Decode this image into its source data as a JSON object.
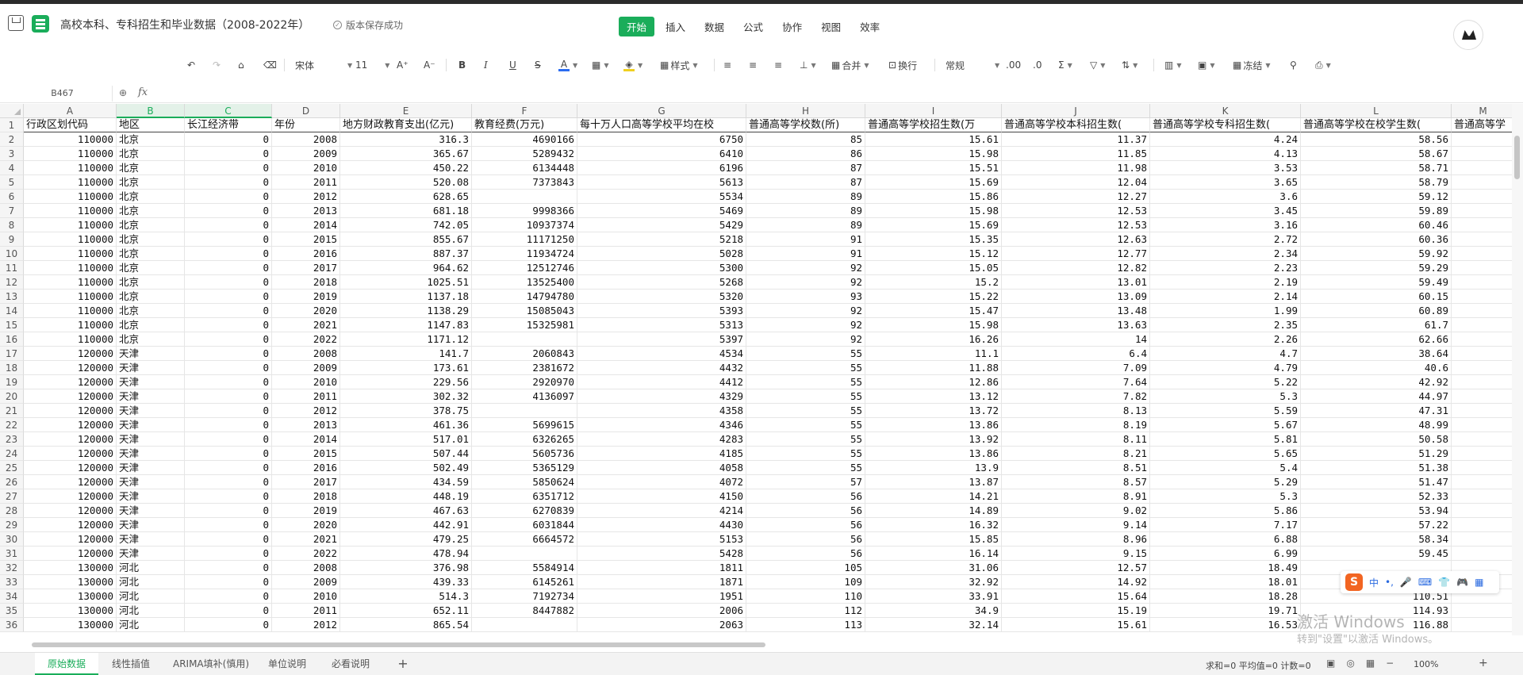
{
  "header": {
    "title": "高校本科、专科招生和毕业数据（2008-2022年）",
    "save_status": "版本保存成功",
    "menu_tabs": [
      "开始",
      "插入",
      "数据",
      "公式",
      "协作",
      "视图",
      "效率"
    ],
    "active_tab": "开始"
  },
  "toolbar": {
    "font_name": "宋体",
    "font_size": "11",
    "font_grow": "A⁺",
    "font_shrink": "A⁻",
    "bold": "B",
    "italic": "I",
    "underline": "U",
    "strike": "S",
    "font_color": "A",
    "style_label": "样式",
    "merge_label": "合并",
    "wrap_label": "换行",
    "number_format": "常规",
    "freeze_label": "冻结",
    "dec_increase": ".00",
    "dec_decrease": ".0"
  },
  "formula_bar": {
    "name_box": "B467",
    "fx": "fx",
    "value": ""
  },
  "columns": [
    "A",
    "B",
    "C",
    "D",
    "E",
    "F",
    "G",
    "H",
    "I",
    "J",
    "K",
    "L",
    "M"
  ],
  "headers": [
    "行政区划代码",
    "地区",
    "长江经济带",
    "年份",
    "地方财政教育支出(亿元)",
    "教育经费(万元)",
    "每十万人口高等学校平均在校",
    "普通高等学校数(所)",
    "普通高等学校招生数(万",
    "普通高等学校本科招生数(",
    "普通高等学校专科招生数(",
    "普通高等学校在校学生数(",
    "普通高等学"
  ],
  "rows": [
    [
      "110000",
      "北京",
      "0",
      "2008",
      "316.3",
      "4690166",
      "6750",
      "85",
      "15.61",
      "11.37",
      "4.24",
      "58.56"
    ],
    [
      "110000",
      "北京",
      "0",
      "2009",
      "365.67",
      "5289432",
      "6410",
      "86",
      "15.98",
      "11.85",
      "4.13",
      "58.67"
    ],
    [
      "110000",
      "北京",
      "0",
      "2010",
      "450.22",
      "6134448",
      "6196",
      "87",
      "15.51",
      "11.98",
      "3.53",
      "58.71"
    ],
    [
      "110000",
      "北京",
      "0",
      "2011",
      "520.08",
      "7373843",
      "5613",
      "87",
      "15.69",
      "12.04",
      "3.65",
      "58.79"
    ],
    [
      "110000",
      "北京",
      "0",
      "2012",
      "628.65",
      "",
      "5534",
      "89",
      "15.86",
      "12.27",
      "3.6",
      "59.12"
    ],
    [
      "110000",
      "北京",
      "0",
      "2013",
      "681.18",
      "9998366",
      "5469",
      "89",
      "15.98",
      "12.53",
      "3.45",
      "59.89"
    ],
    [
      "110000",
      "北京",
      "0",
      "2014",
      "742.05",
      "10937374",
      "5429",
      "89",
      "15.69",
      "12.53",
      "3.16",
      "60.46"
    ],
    [
      "110000",
      "北京",
      "0",
      "2015",
      "855.67",
      "11171250",
      "5218",
      "91",
      "15.35",
      "12.63",
      "2.72",
      "60.36"
    ],
    [
      "110000",
      "北京",
      "0",
      "2016",
      "887.37",
      "11934724",
      "5028",
      "91",
      "15.12",
      "12.77",
      "2.34",
      "59.92"
    ],
    [
      "110000",
      "北京",
      "0",
      "2017",
      "964.62",
      "12512746",
      "5300",
      "92",
      "15.05",
      "12.82",
      "2.23",
      "59.29"
    ],
    [
      "110000",
      "北京",
      "0",
      "2018",
      "1025.51",
      "13525400",
      "5268",
      "92",
      "15.2",
      "13.01",
      "2.19",
      "59.49"
    ],
    [
      "110000",
      "北京",
      "0",
      "2019",
      "1137.18",
      "14794780",
      "5320",
      "93",
      "15.22",
      "13.09",
      "2.14",
      "60.15"
    ],
    [
      "110000",
      "北京",
      "0",
      "2020",
      "1138.29",
      "15085043",
      "5393",
      "92",
      "15.47",
      "13.48",
      "1.99",
      "60.89"
    ],
    [
      "110000",
      "北京",
      "0",
      "2021",
      "1147.83",
      "15325981",
      "5313",
      "92",
      "15.98",
      "13.63",
      "2.35",
      "61.7"
    ],
    [
      "110000",
      "北京",
      "0",
      "2022",
      "1171.12",
      "",
      "5397",
      "92",
      "16.26",
      "14",
      "2.26",
      "62.66"
    ],
    [
      "120000",
      "天津",
      "0",
      "2008",
      "141.7",
      "2060843",
      "4534",
      "55",
      "11.1",
      "6.4",
      "4.7",
      "38.64"
    ],
    [
      "120000",
      "天津",
      "0",
      "2009",
      "173.61",
      "2381672",
      "4432",
      "55",
      "11.88",
      "7.09",
      "4.79",
      "40.6"
    ],
    [
      "120000",
      "天津",
      "0",
      "2010",
      "229.56",
      "2920970",
      "4412",
      "55",
      "12.86",
      "7.64",
      "5.22",
      "42.92"
    ],
    [
      "120000",
      "天津",
      "0",
      "2011",
      "302.32",
      "4136097",
      "4329",
      "55",
      "13.12",
      "7.82",
      "5.3",
      "44.97"
    ],
    [
      "120000",
      "天津",
      "0",
      "2012",
      "378.75",
      "",
      "4358",
      "55",
      "13.72",
      "8.13",
      "5.59",
      "47.31"
    ],
    [
      "120000",
      "天津",
      "0",
      "2013",
      "461.36",
      "5699615",
      "4346",
      "55",
      "13.86",
      "8.19",
      "5.67",
      "48.99"
    ],
    [
      "120000",
      "天津",
      "0",
      "2014",
      "517.01",
      "6326265",
      "4283",
      "55",
      "13.92",
      "8.11",
      "5.81",
      "50.58"
    ],
    [
      "120000",
      "天津",
      "0",
      "2015",
      "507.44",
      "5605736",
      "4185",
      "55",
      "13.86",
      "8.21",
      "5.65",
      "51.29"
    ],
    [
      "120000",
      "天津",
      "0",
      "2016",
      "502.49",
      "5365129",
      "4058",
      "55",
      "13.9",
      "8.51",
      "5.4",
      "51.38"
    ],
    [
      "120000",
      "天津",
      "0",
      "2017",
      "434.59",
      "5850624",
      "4072",
      "57",
      "13.87",
      "8.57",
      "5.29",
      "51.47"
    ],
    [
      "120000",
      "天津",
      "0",
      "2018",
      "448.19",
      "6351712",
      "4150",
      "56",
      "14.21",
      "8.91",
      "5.3",
      "52.33"
    ],
    [
      "120000",
      "天津",
      "0",
      "2019",
      "467.63",
      "6270839",
      "4214",
      "56",
      "14.89",
      "9.02",
      "5.86",
      "53.94"
    ],
    [
      "120000",
      "天津",
      "0",
      "2020",
      "442.91",
      "6031844",
      "4430",
      "56",
      "16.32",
      "9.14",
      "7.17",
      "57.22"
    ],
    [
      "120000",
      "天津",
      "0",
      "2021",
      "479.25",
      "6664572",
      "5153",
      "56",
      "15.85",
      "8.96",
      "6.88",
      "58.34"
    ],
    [
      "120000",
      "天津",
      "0",
      "2022",
      "478.94",
      "",
      "5428",
      "56",
      "16.14",
      "9.15",
      "6.99",
      "59.45"
    ],
    [
      "130000",
      "河北",
      "0",
      "2008",
      "376.98",
      "5584914",
      "1811",
      "105",
      "31.06",
      "12.57",
      "18.49",
      ""
    ],
    [
      "130000",
      "河北",
      "0",
      "2009",
      "439.33",
      "6145261",
      "1871",
      "109",
      "32.92",
      "14.92",
      "18.01",
      ""
    ],
    [
      "130000",
      "河北",
      "0",
      "2010",
      "514.3",
      "7192734",
      "1951",
      "110",
      "33.91",
      "15.64",
      "18.28",
      "110.51"
    ],
    [
      "130000",
      "河北",
      "0",
      "2011",
      "652.11",
      "8447882",
      "2006",
      "112",
      "34.9",
      "15.19",
      "19.71",
      "114.93"
    ],
    [
      "130000",
      "河北",
      "0",
      "2012",
      "865.54",
      "",
      "2063",
      "113",
      "32.14",
      "15.61",
      "16.53",
      "116.88"
    ]
  ],
  "sheet_tabs": [
    "原始数据",
    "线性插值",
    "ARIMA填补(慎用)",
    "单位说明",
    "必看说明"
  ],
  "active_sheet": "原始数据",
  "add_sheet": "+",
  "status": "求和=0  平均值=0  计数=0",
  "zoom": "100%",
  "ime": {
    "logo": "S",
    "items": [
      "中",
      "•,",
      "🎤",
      "⌨",
      "👕",
      "🎮",
      "▦"
    ]
  },
  "watermark": {
    "line1": "激活 Windows",
    "line2": "转到\"设置\"以激活 Windows。"
  }
}
